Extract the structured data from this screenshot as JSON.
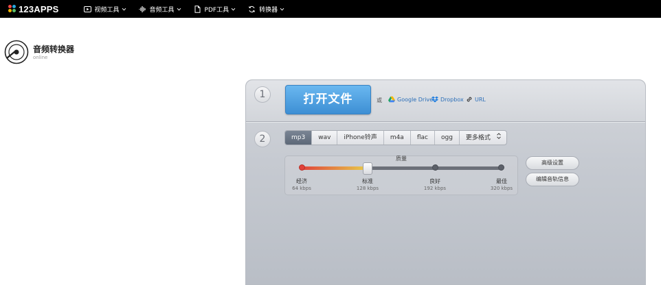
{
  "nav": {
    "logo_text": "123APPS",
    "logo_colors": [
      "#f04848",
      "#29a8e0",
      "#f5b800",
      "#5cc16a"
    ],
    "items": [
      {
        "label": "视频工具",
        "icon": "play-icon"
      },
      {
        "label": "音频工具",
        "icon": "waveform-icon"
      },
      {
        "label": "PDF工具",
        "icon": "document-icon"
      },
      {
        "label": "转换器",
        "icon": "convert-icon"
      }
    ]
  },
  "tool": {
    "title": "音频转换器",
    "subtitle": "online",
    "icon": "disc-icon"
  },
  "step1": {
    "number": "1",
    "open_label": "打开文件",
    "or_label": "或",
    "sources": [
      {
        "label": "Google Drive",
        "icon": "google-drive-icon"
      },
      {
        "label": "Dropbox",
        "icon": "dropbox-icon"
      },
      {
        "label": "URL",
        "icon": "link-icon"
      }
    ]
  },
  "step2": {
    "number": "2",
    "formats": [
      "mp3",
      "wav",
      "iPhone铃声",
      "m4a",
      "flac",
      "ogg",
      "更多格式"
    ],
    "selected_format": "mp3",
    "quality": {
      "title": "质量",
      "level": 2,
      "levels": [
        {
          "name": "经济",
          "rate": "64 kbps"
        },
        {
          "name": "标准",
          "rate": "128 kbps"
        },
        {
          "name": "良好",
          "rate": "192 kbps"
        },
        {
          "name": "最佳",
          "rate": "320 kbps"
        }
      ]
    },
    "advanced_label": "高级设置",
    "edit_info_label": "编辑音轨信息"
  },
  "colors": {
    "accent": "#3d8fd4",
    "nav_bg": "#000000"
  }
}
